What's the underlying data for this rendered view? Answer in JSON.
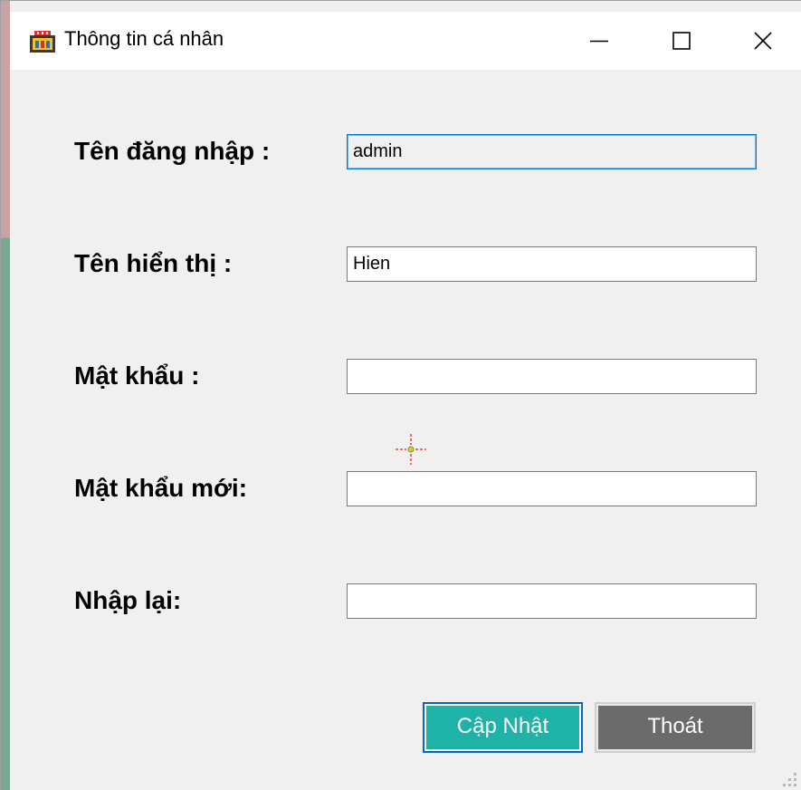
{
  "window": {
    "title": "Thông tin cá nhân",
    "icon": "monitor-app-icon"
  },
  "caption_buttons": {
    "minimize_icon": "minimize-icon",
    "maximize_icon": "maximize-icon",
    "close_icon": "close-icon"
  },
  "form": {
    "username_label": "Tên đăng nhập :",
    "username_value": "admin",
    "display_name_label": "Tên hiển thị :",
    "display_name_value": "Hien",
    "password_label": "Mật khẩu :",
    "password_value": "",
    "new_password_label": "Mật khẩu mới:",
    "new_password_value": "",
    "confirm_label": "Nhập lại:",
    "confirm_value": ""
  },
  "actions": {
    "update_label": "Cập Nhật",
    "exit_label": "Thoát"
  },
  "colors": {
    "update_button_bg": "#1fb2a6",
    "exit_button_bg": "#6b6b6b",
    "focus_border": "#0078d7",
    "window_bg": "#f0f0f0"
  }
}
